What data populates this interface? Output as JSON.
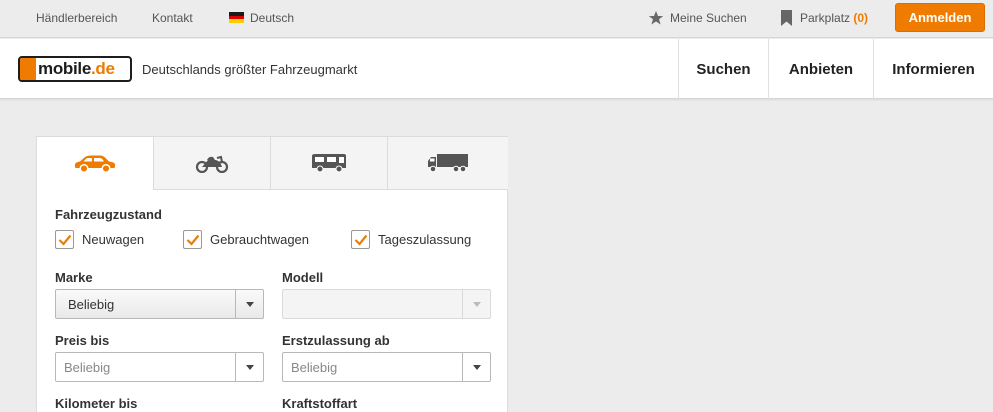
{
  "topbar": {
    "dealer": "Händlerbereich",
    "contact": "Kontakt",
    "language": "Deutsch",
    "saved_searches": "Meine Suchen",
    "parking_label": "Parkplatz",
    "parking_count": "(0)",
    "login": "Anmelden"
  },
  "header": {
    "logo_text": "mobile",
    "logo_tld": ".de",
    "tagline": "Deutschlands größter Fahrzeugmarkt",
    "nav": [
      "Suchen",
      "Anbieten",
      "Informieren"
    ]
  },
  "tabs": [
    {
      "icon": "car-icon",
      "active": true
    },
    {
      "icon": "motorcycle-icon",
      "active": false
    },
    {
      "icon": "motorhome-icon",
      "active": false
    },
    {
      "icon": "truck-icon",
      "active": false
    }
  ],
  "form": {
    "condition_label": "Fahrzeugzustand",
    "conditions": [
      {
        "label": "Neuwagen",
        "checked": true
      },
      {
        "label": "Gebrauchtwagen",
        "checked": true
      },
      {
        "label": "Tageszulassung",
        "checked": true
      }
    ],
    "make_label": "Marke",
    "make_value": "Beliebig",
    "model_label": "Modell",
    "model_value": "",
    "price_label": "Preis bis",
    "price_placeholder": "Beliebig",
    "reg_label": "Erstzulassung ab",
    "reg_placeholder": "Beliebig",
    "km_label": "Kilometer bis",
    "fuel_label": "Kraftstoffart"
  },
  "colors": {
    "accent": "#ef7c00",
    "background": "#ececec",
    "icon_gray": "#555555"
  }
}
